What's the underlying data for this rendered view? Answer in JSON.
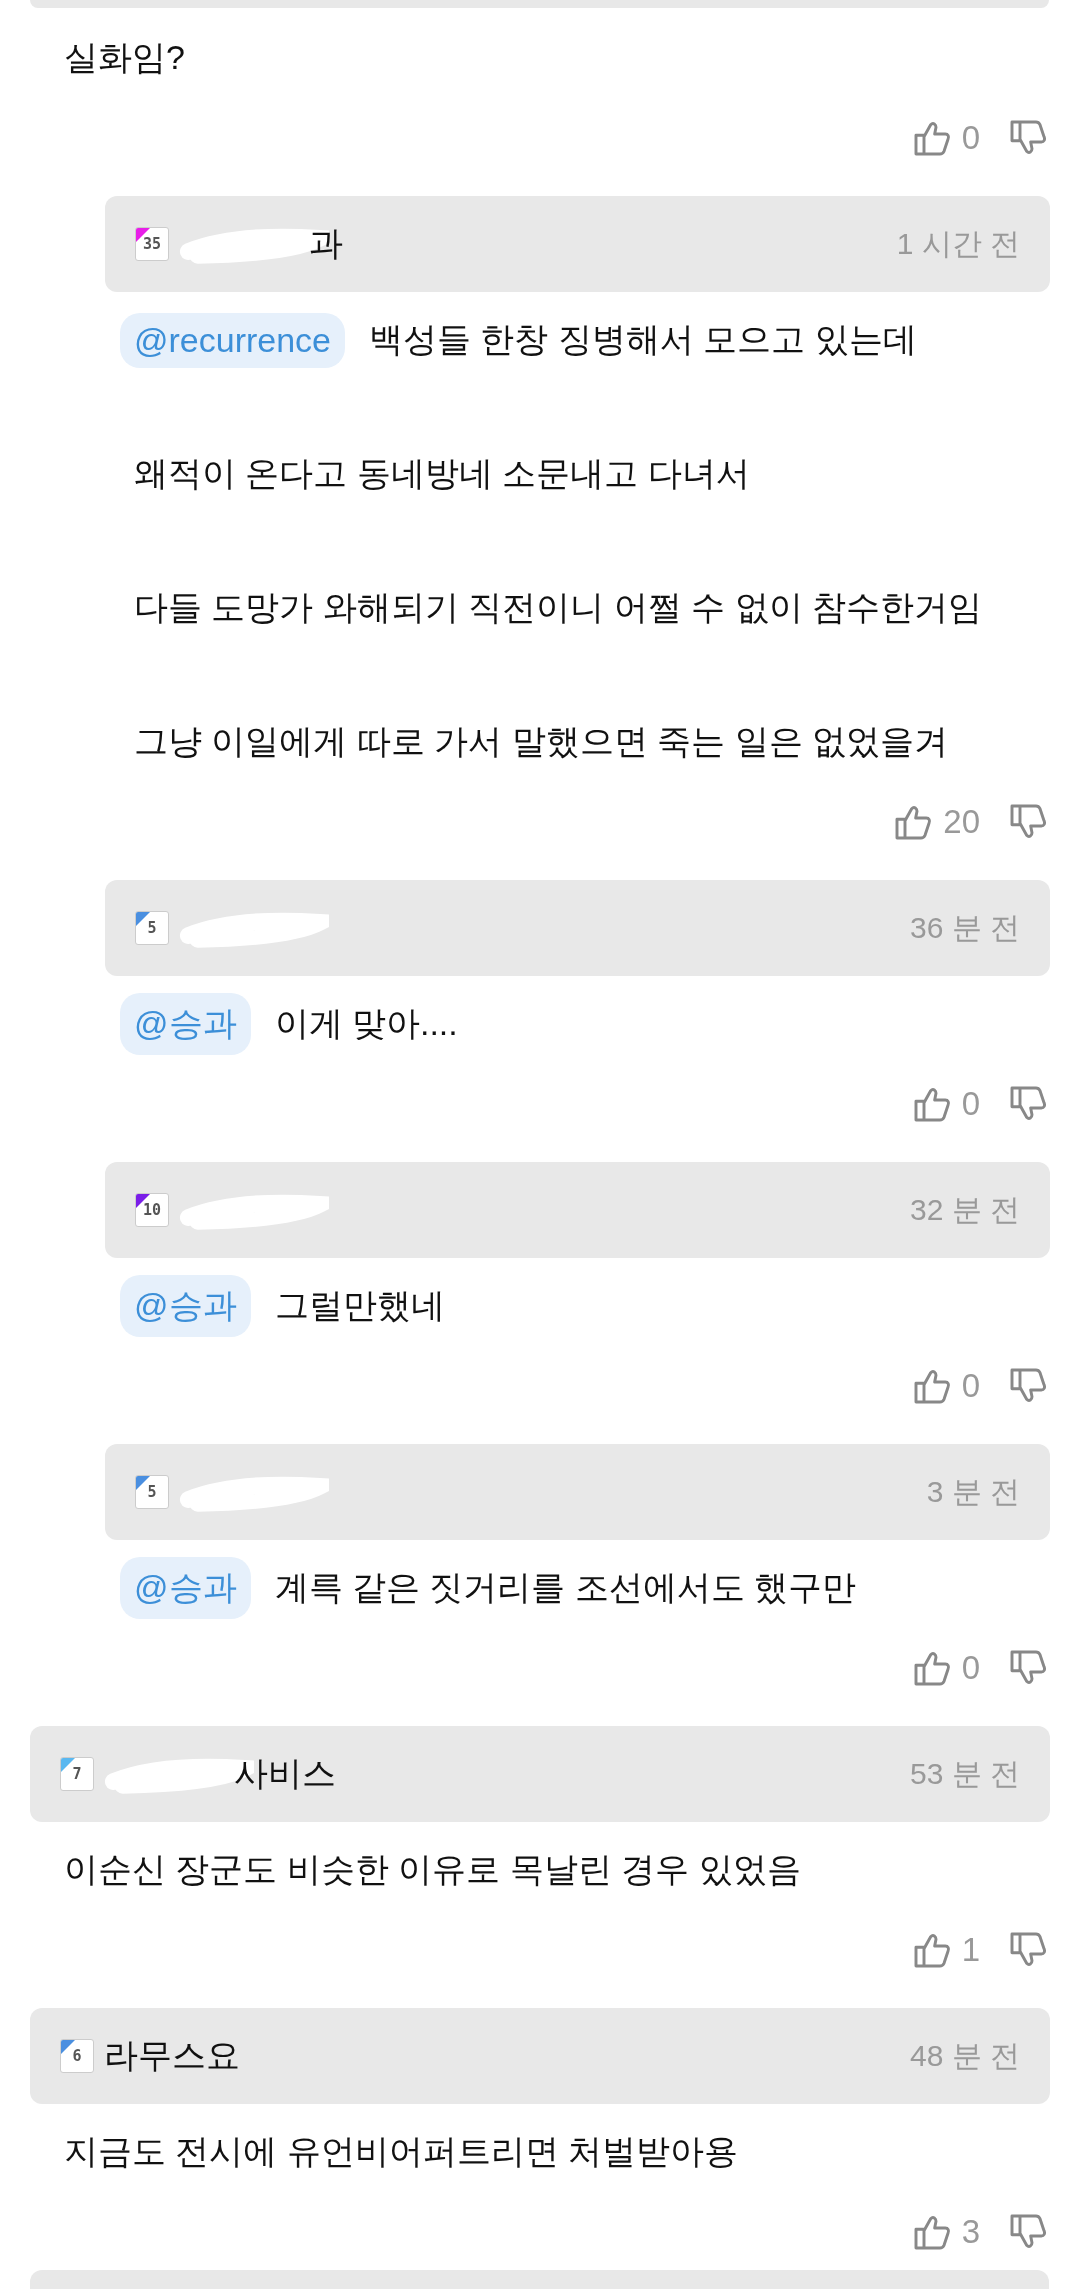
{
  "comments": [
    {
      "text_lines": [
        "실화임?"
      ],
      "likes": "0",
      "replies": [
        {
          "level": "35",
          "color": "#e81ee8",
          "redacted": true,
          "name": "과",
          "time": "1 시간 전",
          "mention": "@recurrence",
          "text_lines": [
            "백성들 한창 징병해서 모으고 있는데",
            "왜적이 온다고 동네방네 소문내고 다녀서",
            "다들 도망가 와해되기 직전이니 어쩔 수 없이 참수한거임",
            "그냥 이일에게 따로 가서 말했으면 죽는 일은 없었을겨"
          ],
          "likes": "20"
        },
        {
          "level": "5",
          "color": "#4a8fe0",
          "redacted": true,
          "time": "36 분 전",
          "mention": "@승과",
          "text_lines": [
            "이게 맞아...."
          ],
          "likes": "0"
        },
        {
          "level": "10",
          "color": "#7a1ee8",
          "redacted": true,
          "time": "32 분 전",
          "mention": "@승과",
          "text_lines": [
            "그럴만했네"
          ],
          "likes": "0"
        },
        {
          "level": "5",
          "color": "#4a8fe0",
          "redacted": true,
          "time": "3 분 전",
          "mention": "@승과",
          "text_lines": [
            "계륵 같은 짓거리를 조선에서도 했구만"
          ],
          "likes": "0"
        }
      ]
    },
    {
      "level": "7",
      "color": "#5ab8f0",
      "redacted": true,
      "name": "사비스",
      "time": "53 분 전",
      "text_lines": [
        "이순신 장군도 비슷한 이유로 목날린 경우 있었음"
      ],
      "likes": "1"
    },
    {
      "level": "6",
      "color": "#4a8fe0",
      "redacted": false,
      "name": "라무스요",
      "time": "48 분 전",
      "text_lines": [
        "지금도 전시에 유언비어퍼트리면 처벌받아용"
      ],
      "likes": "3"
    }
  ]
}
